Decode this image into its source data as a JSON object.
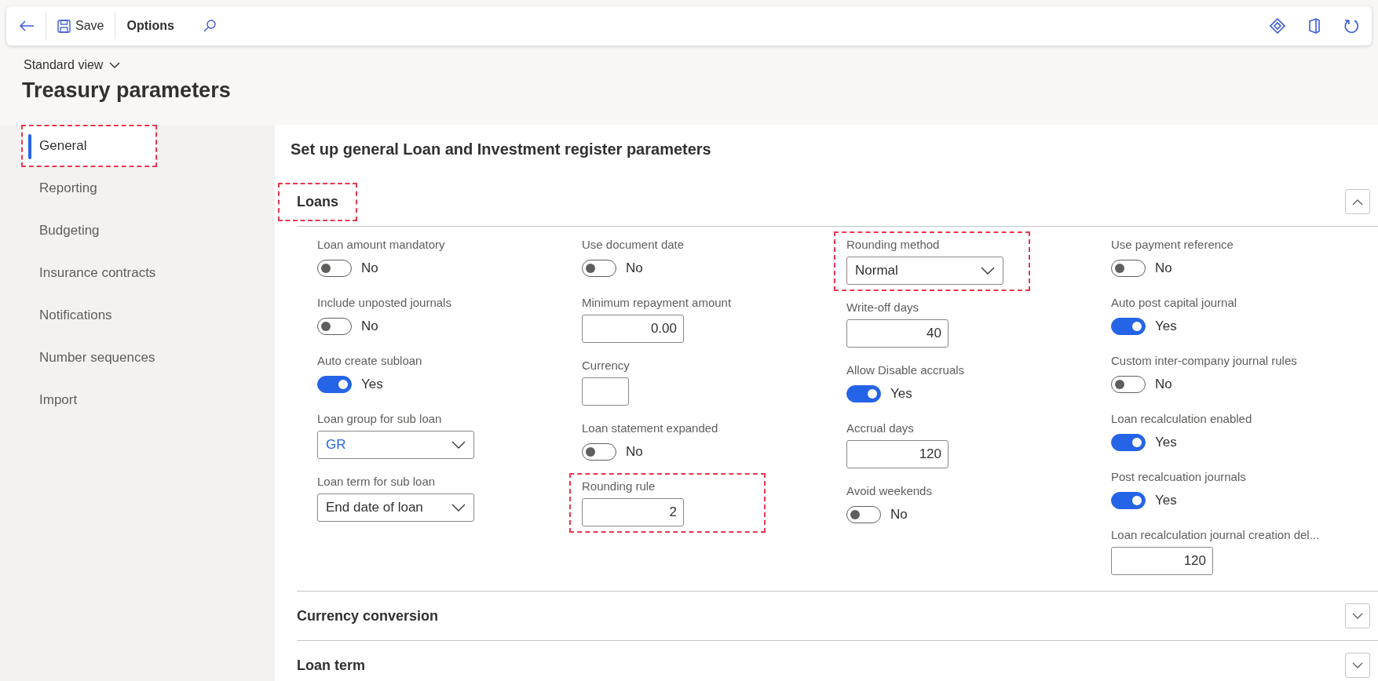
{
  "toolbar": {
    "save_label": "Save",
    "options_label": "Options"
  },
  "view_selector": "Standard view",
  "page_title": "Treasury parameters",
  "sidebar": {
    "items": [
      {
        "label": "General",
        "selected": true,
        "highlighted": true
      },
      {
        "label": "Reporting",
        "selected": false,
        "highlighted": false
      },
      {
        "label": "Budgeting",
        "selected": false,
        "highlighted": false
      },
      {
        "label": "Insurance contracts",
        "selected": false,
        "highlighted": false
      },
      {
        "label": "Notifications",
        "selected": false,
        "highlighted": false
      },
      {
        "label": "Number sequences",
        "selected": false,
        "highlighted": false
      },
      {
        "label": "Import",
        "selected": false,
        "highlighted": false
      }
    ]
  },
  "content": {
    "heading": "Set up general Loan and Investment register parameters",
    "sections": [
      {
        "title": "Loans",
        "expanded": true,
        "highlighted": true,
        "columns": [
          [
            {
              "kind": "toggle",
              "label": "Loan amount mandatory",
              "on": false,
              "value": "No",
              "highlighted": false
            },
            {
              "kind": "toggle",
              "label": "Include unposted journals",
              "on": false,
              "value": "No",
              "highlighted": false
            },
            {
              "kind": "toggle",
              "label": "Auto create subloan",
              "on": true,
              "value": "Yes",
              "highlighted": false
            },
            {
              "kind": "select",
              "label": "Loan group for sub loan",
              "value": "GR",
              "link": true,
              "highlighted": false
            },
            {
              "kind": "select",
              "label": "Loan term for sub loan",
              "value": "End date of loan",
              "link": false,
              "highlighted": false
            }
          ],
          [
            {
              "kind": "toggle",
              "label": "Use document date",
              "on": false,
              "value": "No",
              "highlighted": false
            },
            {
              "kind": "number",
              "label": "Minimum repayment amount",
              "value": "0.00",
              "highlighted": false
            },
            {
              "kind": "text",
              "label": "Currency",
              "highlighted": false
            },
            {
              "kind": "toggle",
              "label": "Loan statement expanded",
              "on": false,
              "value": "No",
              "highlighted": false
            },
            {
              "kind": "number",
              "label": "Rounding rule",
              "value": "2",
              "highlighted": true
            }
          ],
          [
            {
              "kind": "select",
              "label": "Rounding method",
              "value": "Normal",
              "link": false,
              "highlighted": true
            },
            {
              "kind": "number",
              "label": "Write-off days",
              "value": "40",
              "highlighted": false
            },
            {
              "kind": "toggle",
              "label": "Allow Disable accruals",
              "on": true,
              "value": "Yes",
              "highlighted": false
            },
            {
              "kind": "number",
              "label": "Accrual days",
              "value": "120",
              "highlighted": false
            },
            {
              "kind": "toggle",
              "label": "Avoid weekends",
              "on": false,
              "value": "No",
              "highlighted": false
            }
          ],
          [
            {
              "kind": "toggle",
              "label": "Use payment reference",
              "on": false,
              "value": "No",
              "highlighted": false
            },
            {
              "kind": "toggle",
              "label": "Auto post capital journal",
              "on": true,
              "value": "Yes",
              "highlighted": false
            },
            {
              "kind": "toggle",
              "label": "Custom inter-company journal rules",
              "on": false,
              "value": "No",
              "highlighted": false
            },
            {
              "kind": "toggle",
              "label": "Loan recalculation enabled",
              "on": true,
              "value": "Yes",
              "highlighted": false
            },
            {
              "kind": "toggle",
              "label": "Post recalcuation journals",
              "on": true,
              "value": "Yes",
              "highlighted": false
            },
            {
              "kind": "number",
              "label": "Loan recalculation journal creation del...",
              "value": "120",
              "highlighted": false
            }
          ]
        ]
      },
      {
        "title": "Currency conversion",
        "expanded": false,
        "highlighted": false
      },
      {
        "title": "Loan term",
        "expanded": false,
        "highlighted": false
      }
    ]
  }
}
